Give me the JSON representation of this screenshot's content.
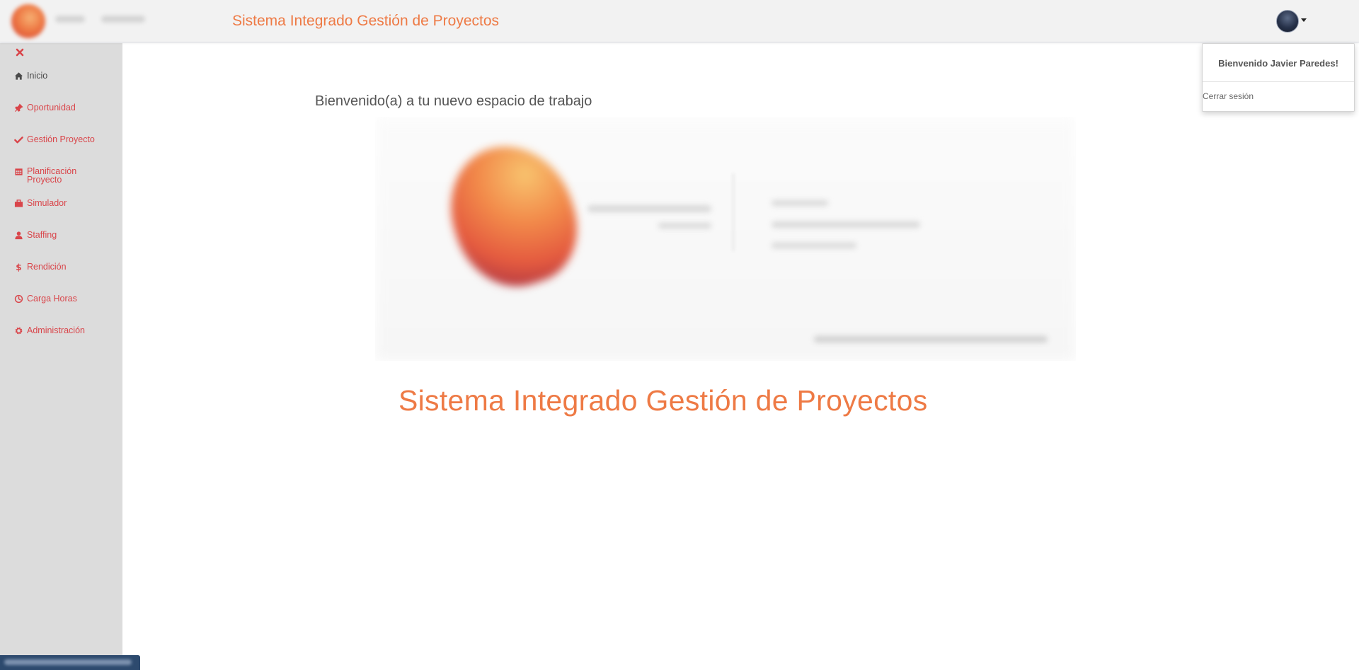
{
  "header": {
    "app_title": "Sistema Integrado Gestión de Proyectos"
  },
  "sidebar": {
    "items": [
      {
        "label": "Inicio",
        "icon": "home-icon"
      },
      {
        "label": "Oportunidad",
        "icon": "pin-icon"
      },
      {
        "label": "Gestión Proyecto",
        "icon": "check-icon"
      },
      {
        "label": "Planificación",
        "label2": "Proyecto",
        "icon": "calendar-icon"
      },
      {
        "label": "Simulador",
        "icon": "briefcase-icon"
      },
      {
        "label": "Staffing",
        "icon": "user-icon"
      },
      {
        "label": "Rendición",
        "icon": "dollar-icon"
      },
      {
        "label": "Carga Horas",
        "icon": "clock-icon"
      },
      {
        "label": "Administración",
        "icon": "gear-icon"
      }
    ],
    "close_icon": "close-icon"
  },
  "main": {
    "welcome": "Bienvenido(a) a tu nuevo espacio de trabajo",
    "hero_title": "Sistema Integrado Gestión de Proyectos"
  },
  "user_menu": {
    "greeting": "Bienvenido Javier Paredes!",
    "logout": "Cerrar sesión"
  },
  "colors": {
    "accent_orange": "#ee7a45",
    "nav_red": "#d9454a",
    "sidebar_bg": "#dcdcdc",
    "topbar_bg": "#f2f2f2"
  }
}
